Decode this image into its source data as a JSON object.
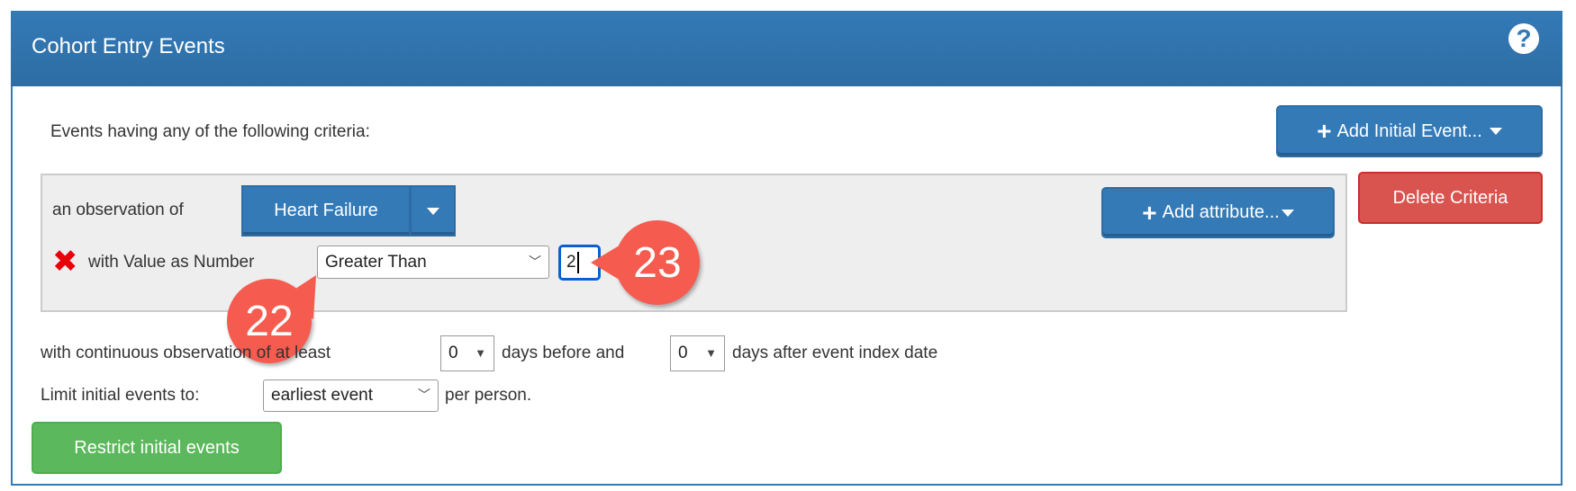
{
  "header": {
    "title": "Cohort Entry Events",
    "help_icon": "question-circle-icon"
  },
  "intro_text": "Events having any of the following criteria:",
  "add_initial_event": {
    "label": "Add Initial Event..."
  },
  "criteria": {
    "observation_label": "an observation of",
    "concept_set": "Heart Failure",
    "add_attribute": "Add attribute...",
    "delete_label": "Delete Criteria",
    "value_label": "with Value as Number",
    "operator": "Greater Than",
    "value": "2"
  },
  "observation": {
    "prefix": "with continuous observation of at least",
    "before": "0",
    "middle": "days before and",
    "after": "0",
    "suffix": "days after event index date"
  },
  "limit": {
    "prefix": "Limit initial events to:",
    "value": "earliest event",
    "suffix": "per person."
  },
  "restrict_button": "Restrict initial events",
  "callouts": [
    "22",
    "23"
  ],
  "colors": {
    "primary": "#337ab7",
    "danger": "#d9534f",
    "success": "#5cb85c",
    "callout": "#f55b4e",
    "remove": "#e8000b"
  }
}
